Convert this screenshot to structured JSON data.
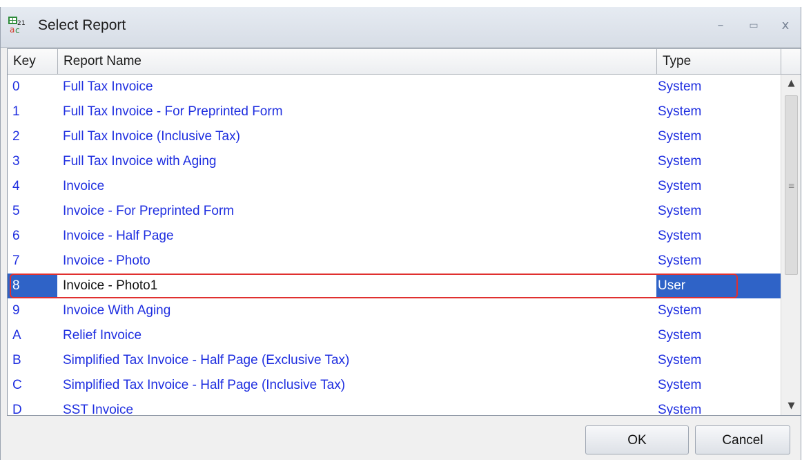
{
  "window": {
    "title": "Select Report",
    "controls": {
      "minimize": "–",
      "maximize": "▭",
      "close": "x"
    }
  },
  "grid": {
    "columns": [
      "Key",
      "Report Name",
      "Type"
    ],
    "rows": [
      {
        "key": "0",
        "name": "Full Tax Invoice",
        "type": "System"
      },
      {
        "key": "1",
        "name": "Full Tax Invoice - For Preprinted Form",
        "type": "System"
      },
      {
        "key": "2",
        "name": "Full Tax Invoice (Inclusive Tax)",
        "type": "System"
      },
      {
        "key": "3",
        "name": "Full Tax Invoice with Aging",
        "type": "System"
      },
      {
        "key": "4",
        "name": "Invoice",
        "type": "System"
      },
      {
        "key": "5",
        "name": "Invoice - For Preprinted Form",
        "type": "System"
      },
      {
        "key": "6",
        "name": "Invoice - Half Page",
        "type": "System"
      },
      {
        "key": "7",
        "name": "Invoice - Photo",
        "type": "System"
      },
      {
        "key": "8",
        "name": "Invoice - Photo1",
        "type": "User"
      },
      {
        "key": "9",
        "name": "Invoice With Aging",
        "type": "System"
      },
      {
        "key": "A",
        "name": "Relief Invoice",
        "type": "System"
      },
      {
        "key": "B",
        "name": "Simplified Tax Invoice - Half Page (Exclusive Tax)",
        "type": "System"
      },
      {
        "key": "C",
        "name": "Simplified Tax Invoice - Half Page (Inclusive Tax)",
        "type": "System"
      },
      {
        "key": "D",
        "name": "SST Invoice",
        "type": "System"
      }
    ],
    "selected_index": 8
  },
  "scrollbar": {
    "up_arrow": "▲",
    "down_arrow": "▼",
    "grip": "≡"
  },
  "buttons": {
    "ok": "OK",
    "cancel": "Cancel"
  },
  "colors": {
    "link_text": "#1f2fe0",
    "selection": "#2f63c7",
    "highlight_outline": "#e0302f"
  },
  "icons": {
    "app": "report-grid-icon"
  }
}
